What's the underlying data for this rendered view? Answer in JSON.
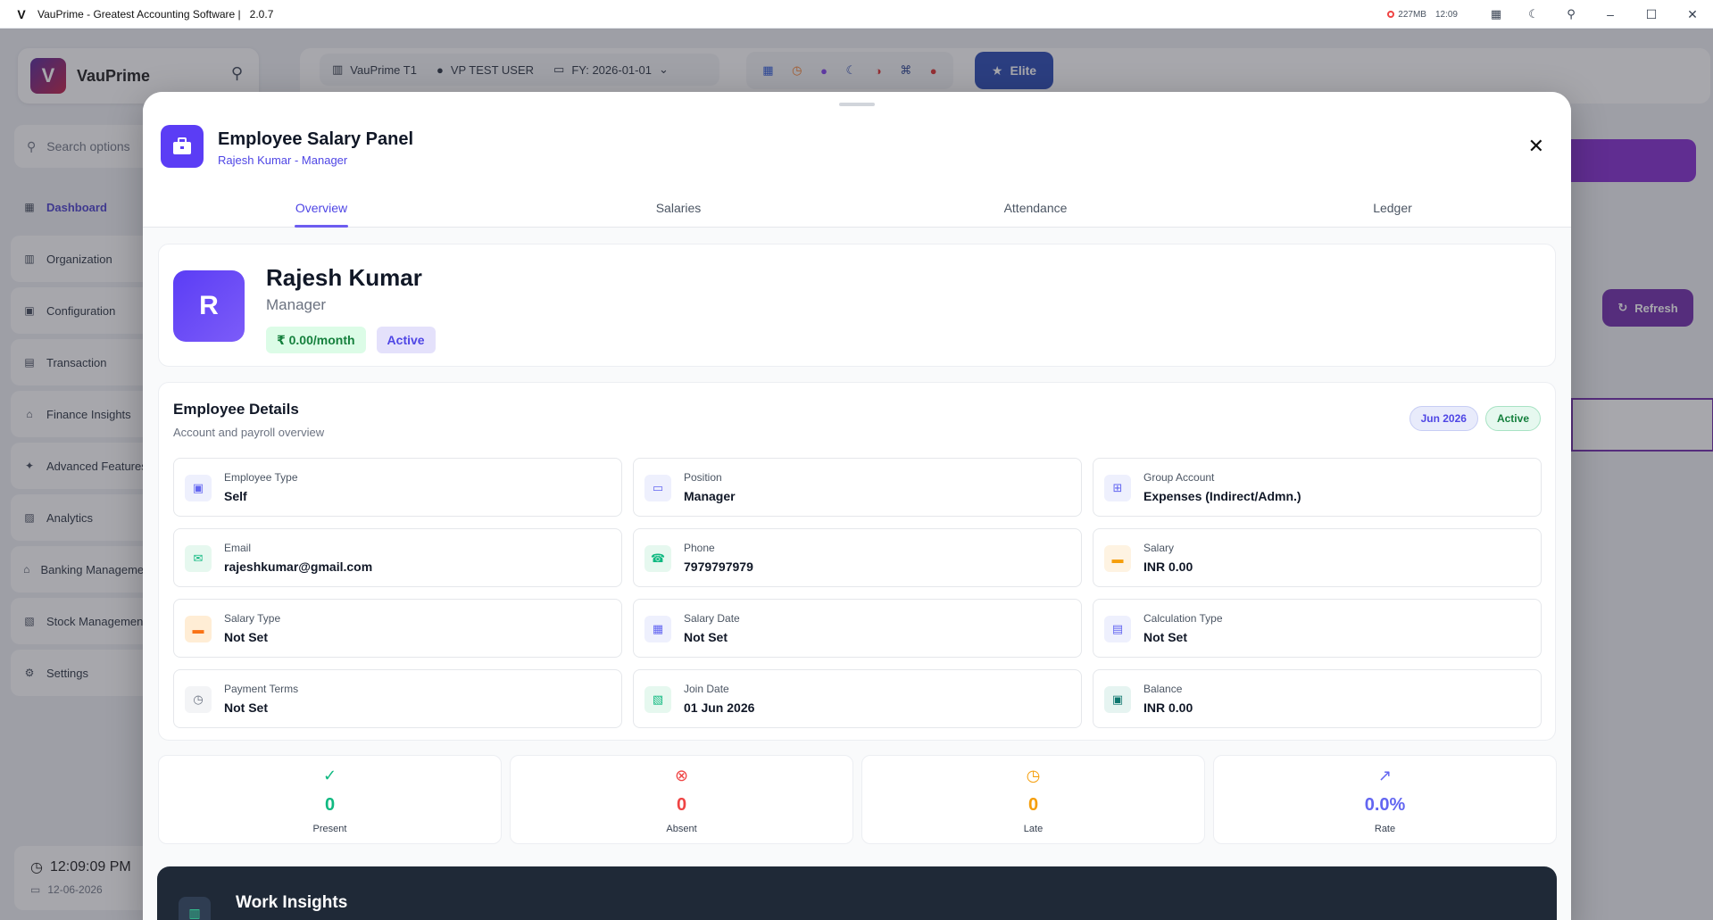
{
  "window": {
    "title": "VauPrime - Greatest Accounting Software |",
    "version": "2.0.7",
    "memory": "227MB",
    "time": "12:09"
  },
  "app": {
    "brand": "VauPrime",
    "search_placeholder": "Search options",
    "nav": [
      {
        "label": "Dashboard",
        "icon": "dashboard-icon"
      },
      {
        "label": "Organization",
        "icon": "building-icon"
      },
      {
        "label": "Configuration",
        "icon": "config-icon"
      },
      {
        "label": "Transaction",
        "icon": "transaction-icon"
      },
      {
        "label": "Finance Insights",
        "icon": "bank-icon"
      },
      {
        "label": "Advanced Features",
        "icon": "sparkle-icon"
      },
      {
        "label": "Analytics",
        "icon": "chart-icon"
      },
      {
        "label": "Banking Management",
        "icon": "bank-icon"
      },
      {
        "label": "Stock Management",
        "icon": "stock-icon"
      },
      {
        "label": "Settings",
        "icon": "gear-icon"
      }
    ],
    "clock_time": "12:09:09 PM",
    "clock_date": "12-06-2026",
    "company": "VauPrime T1",
    "user": "VP TEST USER",
    "fy": "FY: 2026-01-01",
    "elite": "Elite",
    "refresh": "Refresh"
  },
  "modal": {
    "title": "Employee Salary Panel",
    "subtitle": "Rajesh Kumar - Manager",
    "tabs": [
      "Overview",
      "Salaries",
      "Attendance",
      "Ledger"
    ],
    "active_tab": "Overview",
    "profile": {
      "initial": "R",
      "name": "Rajesh Kumar",
      "role": "Manager",
      "salary_badge": "₹ 0.00/month",
      "status_badge": "Active"
    },
    "details": {
      "title": "Employee Details",
      "subtitle": "Account and payroll overview",
      "period_badge": "Jun 2026",
      "status_badge": "Active",
      "fields": [
        {
          "label": "Employee Type",
          "value": "Self",
          "icon": "id-card-icon",
          "color": "#6366f1",
          "bg": "#eef0fd"
        },
        {
          "label": "Position",
          "value": "Manager",
          "icon": "briefcase-icon",
          "color": "#6366f1",
          "bg": "#eef0fd"
        },
        {
          "label": "Group Account",
          "value": "Expenses (Indirect/Admn.)",
          "icon": "hierarchy-icon",
          "color": "#6366f1",
          "bg": "#eef0fd"
        },
        {
          "label": "Email",
          "value": "rajeshkumar@gmail.com",
          "icon": "mail-icon",
          "color": "#10b981",
          "bg": "#e6f8ef"
        },
        {
          "label": "Phone",
          "value": "7979797979",
          "icon": "phone-icon",
          "color": "#10b981",
          "bg": "#e6f8ef"
        },
        {
          "label": "Salary",
          "value": "INR 0.00",
          "icon": "cash-icon",
          "color": "#f59e0b",
          "bg": "#fef3e2"
        },
        {
          "label": "Salary Type",
          "value": "Not Set",
          "icon": "cash-icon",
          "color": "#f97316",
          "bg": "#ffedd5"
        },
        {
          "label": "Salary Date",
          "value": "Not Set",
          "icon": "calendar-icon",
          "color": "#6366f1",
          "bg": "#eef0fd"
        },
        {
          "label": "Calculation Type",
          "value": "Not Set",
          "icon": "calculator-icon",
          "color": "#6366f1",
          "bg": "#eef0fd"
        },
        {
          "label": "Payment Terms",
          "value": "Not Set",
          "icon": "clock-icon",
          "color": "#6b7280",
          "bg": "#f3f4f6"
        },
        {
          "label": "Join Date",
          "value": "01 Jun 2026",
          "icon": "calendar-check-icon",
          "color": "#10b981",
          "bg": "#e6f8ef"
        },
        {
          "label": "Balance",
          "value": "INR 0.00",
          "icon": "wallet-icon",
          "color": "#0f766e",
          "bg": "#e6f4f1"
        }
      ]
    },
    "stats": [
      {
        "label": "Present",
        "value": "0",
        "icon": "check-circle-icon",
        "color": "#10b981"
      },
      {
        "label": "Absent",
        "value": "0",
        "icon": "x-circle-icon",
        "color": "#ef4444"
      },
      {
        "label": "Late",
        "value": "0",
        "icon": "clock-icon",
        "color": "#f59e0b"
      },
      {
        "label": "Rate",
        "value": "0.0%",
        "icon": "trend-up-icon",
        "color": "#6366f1"
      }
    ],
    "insights_title": "Work Insights"
  }
}
